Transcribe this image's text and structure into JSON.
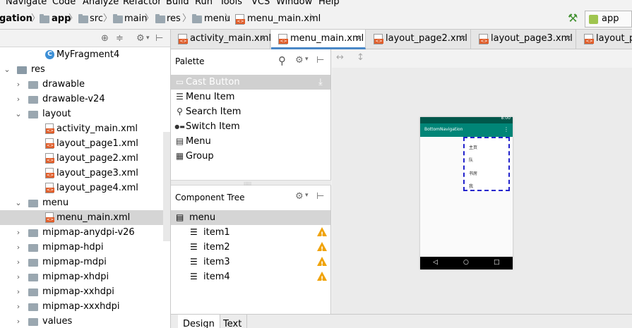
{
  "menubar": [
    "Navigate",
    "Code",
    "Analyze",
    "Refactor",
    "Build",
    "Run",
    "Tools",
    "VCS",
    "Window",
    "Help"
  ],
  "breadcrumb": {
    "root": "gation",
    "app": "app",
    "src": "src",
    "main": "main",
    "res": "res",
    "menu": "menu",
    "file": "menu_main.xml"
  },
  "run_config": "app",
  "project_tree": [
    {
      "label": "MyFragment4",
      "kind": "class",
      "indent": 3
    },
    {
      "label": "res",
      "kind": "folder",
      "indent": 0,
      "chev": "open"
    },
    {
      "label": "drawable",
      "kind": "folder",
      "indent": 1,
      "chev": "closed"
    },
    {
      "label": "drawable-v24",
      "kind": "folder",
      "indent": 1,
      "chev": "closed"
    },
    {
      "label": "layout",
      "kind": "folder",
      "indent": 1,
      "chev": "open"
    },
    {
      "label": "activity_main.xml",
      "kind": "xml",
      "indent": 2
    },
    {
      "label": "layout_page1.xml",
      "kind": "xml",
      "indent": 2
    },
    {
      "label": "layout_page2.xml",
      "kind": "xml",
      "indent": 2
    },
    {
      "label": "layout_page3.xml",
      "kind": "xml",
      "indent": 2
    },
    {
      "label": "layout_page4.xml",
      "kind": "xml",
      "indent": 2
    },
    {
      "label": "menu",
      "kind": "folder",
      "indent": 1,
      "chev": "open"
    },
    {
      "label": "menu_main.xml",
      "kind": "xml",
      "indent": 2,
      "selected": true
    },
    {
      "label": "mipmap-anydpi-v26",
      "kind": "folder",
      "indent": 1,
      "chev": "closed"
    },
    {
      "label": "mipmap-hdpi",
      "kind": "folder",
      "indent": 1,
      "chev": "closed"
    },
    {
      "label": "mipmap-mdpi",
      "kind": "folder",
      "indent": 1,
      "chev": "closed"
    },
    {
      "label": "mipmap-xhdpi",
      "kind": "folder",
      "indent": 1,
      "chev": "closed"
    },
    {
      "label": "mipmap-xxhdpi",
      "kind": "folder",
      "indent": 1,
      "chev": "closed"
    },
    {
      "label": "mipmap-xxxhdpi",
      "kind": "folder",
      "indent": 1,
      "chev": "closed"
    },
    {
      "label": "values",
      "kind": "folder",
      "indent": 1,
      "chev": "closed"
    }
  ],
  "editor_tabs": [
    {
      "label": "activity_main.xml",
      "active": false
    },
    {
      "label": "menu_main.xml",
      "active": true
    },
    {
      "label": "layout_page2.xml",
      "active": false
    },
    {
      "label": "layout_page3.xml",
      "active": false
    },
    {
      "label": "layout_pag",
      "active": false
    }
  ],
  "palette": {
    "title": "Palette",
    "items": [
      {
        "label": "Cast Button",
        "icon": "cast-icon",
        "highlight": true
      },
      {
        "label": "Menu Item",
        "icon": "list-icon"
      },
      {
        "label": "Search Item",
        "icon": "search-icon"
      },
      {
        "label": "Switch Item",
        "icon": "switch-icon"
      },
      {
        "label": "Menu",
        "icon": "menu-icon"
      },
      {
        "label": "Group",
        "icon": "grid-icon"
      }
    ]
  },
  "component_tree": {
    "title": "Component Tree",
    "root": "menu",
    "items": [
      "item1",
      "item2",
      "item3",
      "item4"
    ]
  },
  "preview": {
    "status_time": "8:00",
    "app_title": "BottomNavigation",
    "popup_items": [
      "主页",
      "队",
      "书房",
      "我"
    ]
  },
  "bottom_tabs": [
    {
      "label": "Design",
      "active": true
    },
    {
      "label": "Text",
      "active": false
    }
  ],
  "colors": {
    "accent": "#4a88c7",
    "primary": "#008577",
    "primary_dark": "#00574b",
    "warning": "#f0a30a",
    "xml_icon": "#e05e2b"
  }
}
